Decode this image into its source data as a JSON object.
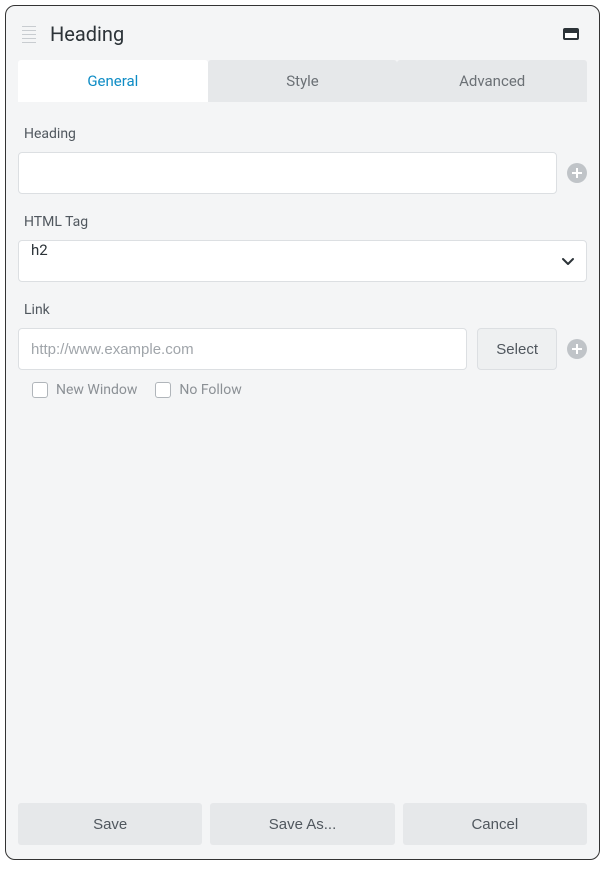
{
  "header": {
    "title": "Heading"
  },
  "tabs": {
    "general": "General",
    "style": "Style",
    "advanced": "Advanced"
  },
  "fields": {
    "heading": {
      "label": "Heading",
      "value": ""
    },
    "html_tag": {
      "label": "HTML Tag",
      "value": "h2"
    },
    "link": {
      "label": "Link",
      "placeholder": "http://www.example.com",
      "value": "",
      "select_button": "Select",
      "new_window": "New Window",
      "no_follow": "No Follow"
    }
  },
  "footer": {
    "save": "Save",
    "save_as": "Save As...",
    "cancel": "Cancel"
  }
}
